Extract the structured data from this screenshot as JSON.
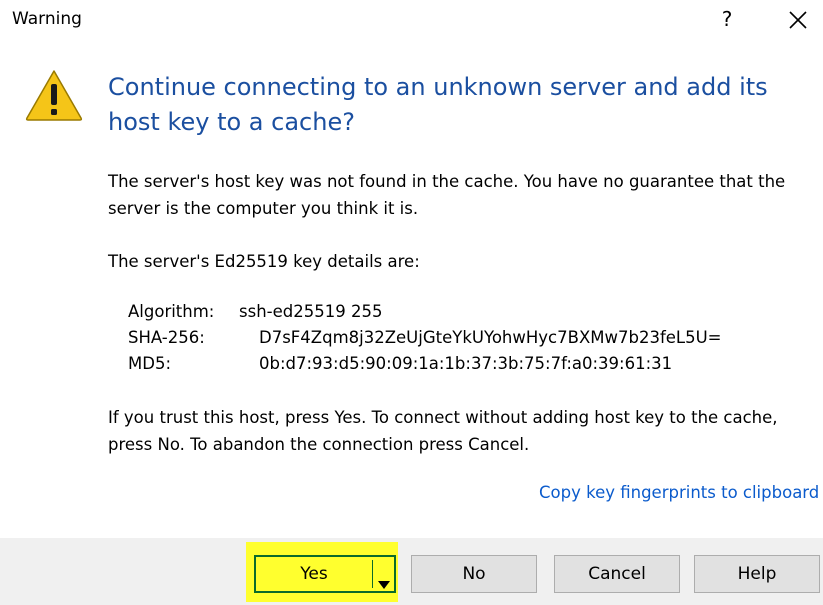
{
  "window": {
    "title": "Warning",
    "help_glyph": "?"
  },
  "icons": {
    "warning": "warning-triangle-icon",
    "close": "close-icon",
    "dropdown": "dropdown-arrow-icon"
  },
  "colors": {
    "instruction": "#1b4fa0",
    "link": "#0b5bcc",
    "highlight": "#ffff2e",
    "highlight_border": "#0b6b2b",
    "warning_fill": "#f5c518"
  },
  "message": {
    "main_instruction": "Continue connecting to an unknown server and add its host key to a cache?",
    "intro": "The server's host key was not found in the cache. You have no guarantee that the server is the computer you think it is.",
    "details_heading": "The server's Ed25519 key details are:",
    "key_details": [
      {
        "label": "Algorithm:",
        "value": "ssh-ed25519 255"
      },
      {
        "label": "SHA-256:",
        "value": "D7sF4Zqm8j32ZeUjGteYkUYohwHyc7BXMw7b23feL5U="
      },
      {
        "label": "MD5:",
        "value": "0b:d7:93:d5:90:09:1a:1b:37:3b:75:7f:a0:39:61:31"
      }
    ],
    "trust_instructions": "If you trust this host, press Yes. To connect without adding host key to the cache, press No. To abandon the connection press Cancel.",
    "copy_link": "Copy key fingerprints to clipboard"
  },
  "buttons": {
    "yes": "Yes",
    "no": "No",
    "cancel": "Cancel",
    "help": "Help"
  }
}
